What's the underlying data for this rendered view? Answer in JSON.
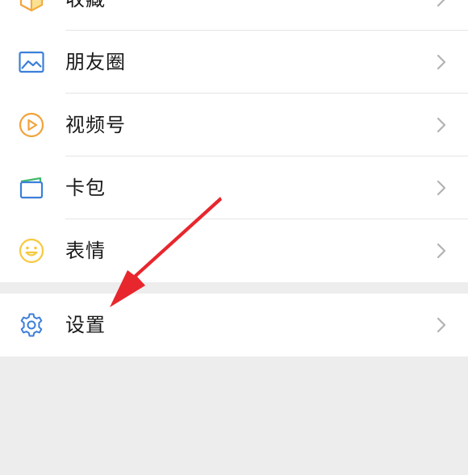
{
  "menu": {
    "items": [
      {
        "label": "收藏",
        "icon": "favorites-cube-icon"
      },
      {
        "label": "朋友圈",
        "icon": "moments-picture-icon"
      },
      {
        "label": "视频号",
        "icon": "channels-play-icon"
      },
      {
        "label": "卡包",
        "icon": "card-wallet-icon"
      },
      {
        "label": "表情",
        "icon": "sticker-smile-icon"
      }
    ],
    "settings": {
      "label": "设置",
      "icon": "gear-icon"
    }
  },
  "colors": {
    "background": "#ededed",
    "row": "#ffffff",
    "text": "#191919",
    "arrow": "#e8262d",
    "icon_blue": "#3b7fd9",
    "icon_orange": "#f2a33a",
    "icon_yellow": "#f7c93e"
  }
}
